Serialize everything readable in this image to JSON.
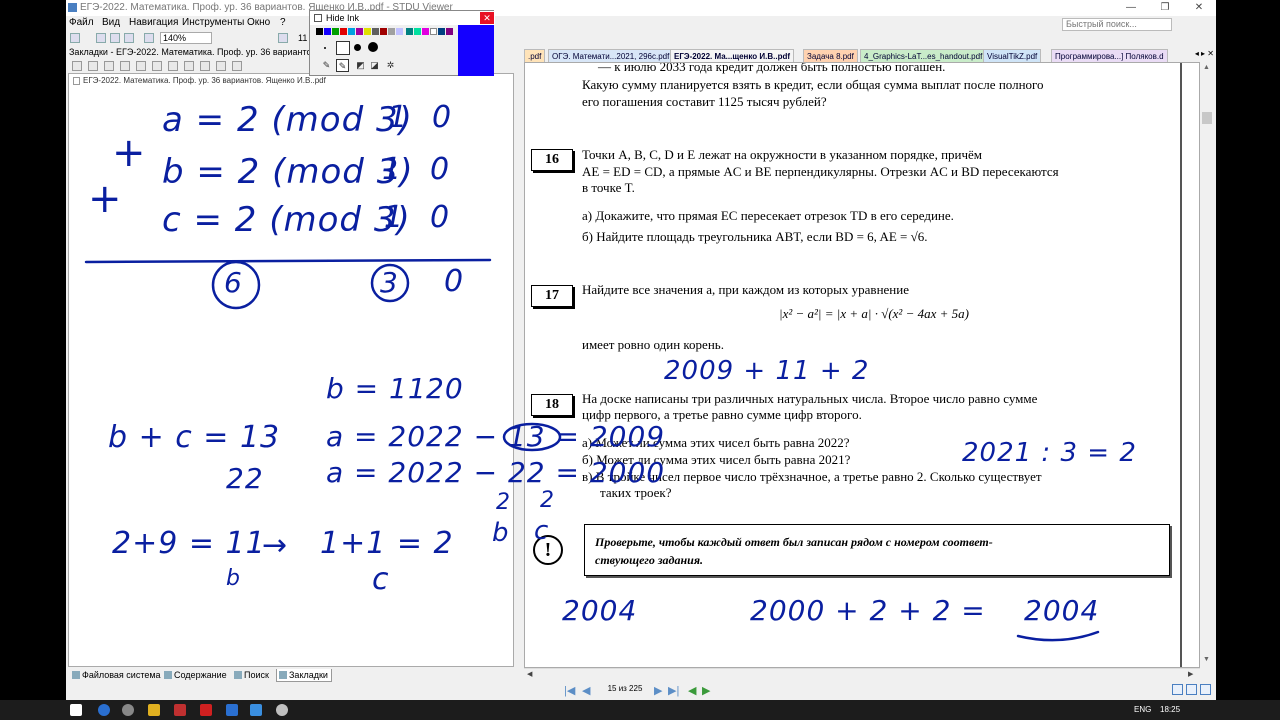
{
  "window": {
    "title": "ЕГЭ-2022. Математика. Проф. ур. 36 вариантов. Ященко И.В..pdf - STDU Viewer",
    "search_placeholder": "Быстрый поиск..."
  },
  "menu": [
    "Файл",
    "Вид",
    "Навигация",
    "Инструменты",
    "Окно",
    "?"
  ],
  "toolbar": {
    "zoom": "140%",
    "page_field": "11"
  },
  "left_panel": {
    "header": "Закладки - ЕГЭ-2022. Математика. Проф. ур. 36 вариантов. Ящен",
    "bookmark": "ЕГЭ-2022. Математика. Проф. ур. 36 вариантов. Ященко И.В..pdf",
    "tabs": [
      "Файловая система",
      "Содержание",
      "Поиск",
      "Закладки"
    ]
  },
  "doc_tabs": [
    ".pdf",
    "ОГЭ. Математи...2021, 296с.pdf",
    "ЕГЭ-2022. Ма...щенко И.В..pdf",
    "Задача 8.pdf",
    "4_Graphics-LaT...es_handout.pdf",
    "VisualTikZ.pdf",
    "Программирова...] Поляков.d"
  ],
  "doc": {
    "top_lines": [
      "— к июлю 2033 года кредит должен быть полностью погашен.",
      "Какую сумму планируется взять в кредит, если общая сумма выплат после полного",
      "его погашения составит 1125 тысяч рублей?"
    ],
    "task16": {
      "num": "16",
      "lines": [
        "Точки A, B, C, D и E лежат на окружности в указанном порядке, причём",
        "AE = ED = CD, а прямые AC и BE перпендикулярны. Отрезки AC и BD пересекаются",
        "в точке T."
      ],
      "a": "а) Докажите, что прямая EC пересекает отрезок TD в его середине.",
      "b": "б) Найдите площадь треугольника ABT, если BD = 6,  AE = √6."
    },
    "task17": {
      "num": "17",
      "line": "Найдите все значения a, при каждом из которых уравнение",
      "formula": "|x² − a²| = |x + a| · √(x² − 4ax + 5a)",
      "line2": "имеет ровно один корень."
    },
    "task18": {
      "num": "18",
      "lines": [
        "На доске написаны три различных натуральных числа. Второе число равно сумме",
        "цифр первого, а третье равно сумме цифр второго."
      ],
      "a": "а) Может ли сумма этих чисел быть равна 2022?",
      "b": "б) Может ли сумма этих чисел быть равна 2021?",
      "c1": "в) В тройке чисел первое число трёхзначное, а третье равно 2. Сколько существует",
      "c2": "таких троек?"
    },
    "note": {
      "excl": "!",
      "line1": "Проверьте, чтобы каждый ответ был записан рядом с номером соответ-",
      "line2": "ствующего задания."
    }
  },
  "status": {
    "page": "15 из 225"
  },
  "hide_ink": {
    "label": "Hide Ink",
    "close": "✕"
  },
  "ink_left": {
    "l1": "a = 2 (mod 3)",
    "l1b": "1",
    "l1c": "0",
    "l2": "b = 2 (mod 3)",
    "l2b": "1",
    "l2c": "0",
    "l3": "c = 2 (mod 3)",
    "l3b": "1",
    "l3c": "0",
    "plus": "+",
    "s1": "6",
    "s2": "3",
    "s3": "0",
    "b11": "b = 11",
    "n20": "20",
    "bc": "b + c = 13",
    "n22": "22",
    "a1": "a = 2022 − 13 = 2009",
    "a2": "a = 2022 − 22 = 2000",
    "two1": "2",
    "two2": "2",
    "lb": "b",
    "lc": "c",
    "r1": "2+9 = 11",
    "r1b": "b",
    "r2": "1+1 = 2",
    "r2c": "c"
  },
  "ink_right": {
    "t17": "2009 + 11 + 2",
    "t18": "2021 : 3 = 2",
    "ans1": "2004",
    "ans2": "2000 + 2 + 2 =",
    "ans3": "2004"
  },
  "taskbar": {
    "lang": "ENG",
    "time": "18:25"
  },
  "colors": {
    "ink": "#0a1fa0",
    "accent": "#4a7fc1",
    "hideink_blue": "#1400ff"
  }
}
